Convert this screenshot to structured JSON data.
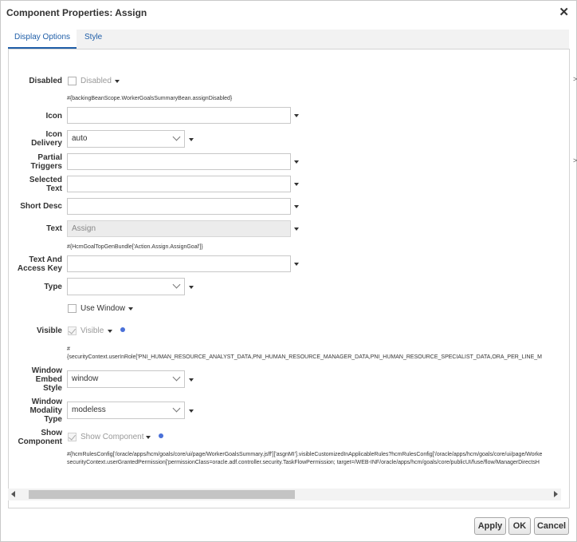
{
  "dialog": {
    "title": "Component Properties: Assign",
    "close_glyph": "✕"
  },
  "tabs": [
    {
      "label": "Display Options",
      "active": true
    },
    {
      "label": "Style",
      "active": false
    }
  ],
  "fields": {
    "disabled": {
      "label": "Disabled",
      "checkbox_label": "Disabled",
      "checked": false,
      "el": "#{backingBeanScope.WorkerGoalsSummaryBean.assignDisabled}"
    },
    "icon": {
      "label": "Icon",
      "value": ""
    },
    "icon_delivery": {
      "label_line1": "Icon",
      "label_line2": "Delivery",
      "value": "auto"
    },
    "partial_triggers": {
      "label_line1": "Partial",
      "label_line2": "Triggers",
      "value": ""
    },
    "selected_text": {
      "label_line1": "Selected",
      "label_line2": "Text",
      "value": ""
    },
    "short_desc": {
      "label": "Short Desc",
      "value": ""
    },
    "text": {
      "label": "Text",
      "placeholder": "Assign",
      "el": "#{HcmGoalTopGenBundle['Action.Assign.AssignGoal']}"
    },
    "text_access_key": {
      "label_line1": "Text And",
      "label_line2": "Access Key",
      "value": ""
    },
    "type": {
      "label": "Type",
      "value": ""
    },
    "use_window": {
      "checkbox_label": "Use Window",
      "checked": false
    },
    "visible": {
      "label": "Visible",
      "checkbox_label": "Visible",
      "checked": true,
      "el_line1": "#",
      "el_line2": "{securityContext.userInRole['PNI_HUMAN_RESOURCE_ANALYST_DATA,PNI_HUMAN_RESOURCE_MANAGER_DATA,PNI_HUMAN_RESOURCE_SPECIALIST_DATA,ORA_PER_LINE_M"
    },
    "window_embed_style": {
      "label_line1": "Window",
      "label_line2": "Embed",
      "label_line3": "Style",
      "value": "window"
    },
    "window_modality_type": {
      "label_line1": "Window",
      "label_line2": "Modality",
      "label_line3": "Type",
      "value": "modeless"
    },
    "show_component": {
      "label_line1": "Show",
      "label_line2": "Component",
      "checkbox_label": "Show Component",
      "checked": true,
      "el_line1": "#{hcmRulesConfig['/oracle/apps/hcm/goals/core/ui/page/WorkerGoalsSummary.jsff']['asgnMI'].visibleCustomizedInApplicableRules?hcmRulesConfig['/oracle/apps/hcm/goals/core/ui/page/Worke",
      "el_line2": "securityContext.userGrantedPermission['permissionClass=oracle.adf.controller.security.TaskFlowPermission; target=/WEB-INF/oracle/apps/hcm/goals/core/publicUI/fuse/flow/ManagerDirectsH"
    }
  },
  "buttons": {
    "apply": "Apply",
    "ok": "OK",
    "cancel": "Cancel"
  },
  "edge_glyphs": [
    ">",
    ">"
  ],
  "colors": {
    "accent": "#1f5ea8",
    "info_dot": "#4a70d8"
  }
}
